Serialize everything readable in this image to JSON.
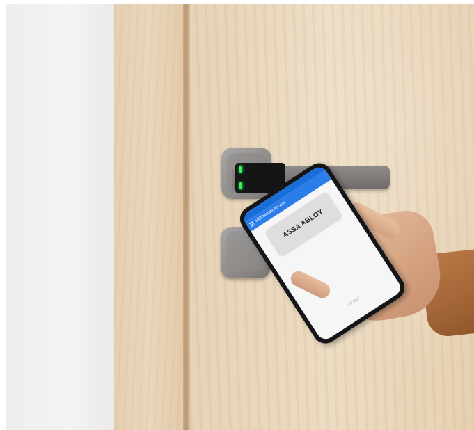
{
  "scene": {
    "subject": "door lock with phone unlock"
  },
  "phone": {
    "status_text": "",
    "app_title": "HID Mobile Access",
    "credential": {
      "brand_label": "ASSA ABLOY"
    },
    "bottom_label": "UNLOCK"
  },
  "colors": {
    "app_bar": "#2b7de9",
    "led": "#32f05a",
    "sleeve": "#a8693a"
  }
}
